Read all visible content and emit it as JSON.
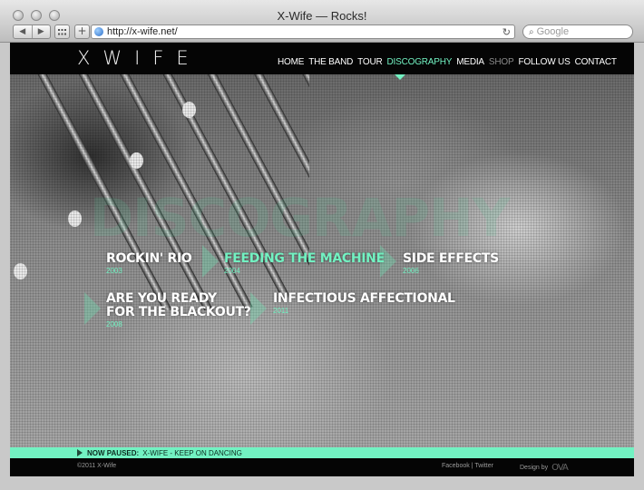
{
  "browser": {
    "window_title": "X-Wife — Rocks!",
    "url": "http://x-wife.net/",
    "search_placeholder": "Google"
  },
  "site": {
    "logo": "XWIFE",
    "menu": [
      {
        "label": "HOME",
        "state": "normal"
      },
      {
        "label": "THE BAND",
        "state": "normal"
      },
      {
        "label": "TOUR",
        "state": "normal"
      },
      {
        "label": "DISCOGRAPHY",
        "state": "active"
      },
      {
        "label": "MEDIA",
        "state": "normal"
      },
      {
        "label": "SHOP",
        "state": "muted"
      },
      {
        "label": "FOLLOW US",
        "state": "normal"
      },
      {
        "label": "CONTACT",
        "state": "normal"
      }
    ],
    "hero_word": "DISCOGRAPHY",
    "albums": [
      {
        "title": "ROCKIN' RIO",
        "year": "2003",
        "highlighted": false
      },
      {
        "title": "FEEDING THE MACHINE",
        "year": "2004",
        "highlighted": true
      },
      {
        "title": "SIDE EFFECTS",
        "year": "2006",
        "highlighted": false
      },
      {
        "title": "ARE YOU READY\nFOR THE BLACKOUT?",
        "year": "2008",
        "highlighted": false
      },
      {
        "title": "INFECTIOUS AFFECTIONAL",
        "year": "2011",
        "highlighted": false
      }
    ],
    "player": {
      "label": "NOW PAUSED:",
      "track": "X-WIFE - KEEP ON DANCING"
    },
    "footer": {
      "copyright": "©2011 X-Wife",
      "social": [
        "Facebook",
        "Twitter"
      ],
      "social_separator": "|",
      "design_label": "Design by",
      "designer_logo": "OVA"
    }
  },
  "colors": {
    "accent": "#72f2c2",
    "header_bg": "#050505",
    "muted_menu": "#8a8a8a"
  }
}
